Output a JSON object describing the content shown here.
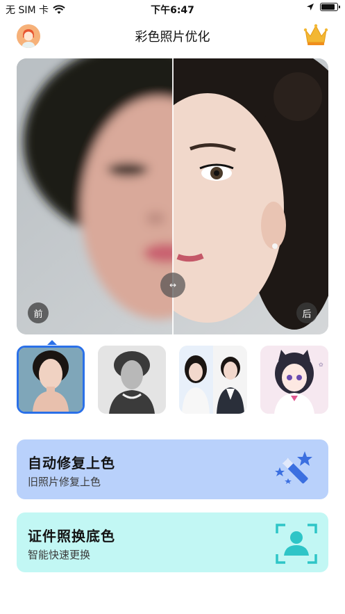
{
  "status_bar": {
    "carrier": "无 SIM 卡",
    "time": "下午6:47",
    "battery_level": 0.9
  },
  "header": {
    "title": "彩色照片优化",
    "avatar_icon": "user-avatar-icon",
    "vip_icon": "crown-icon"
  },
  "compare": {
    "before_label": "前",
    "after_label": "后",
    "handle_label": "↔"
  },
  "thumbnails": [
    {
      "name": "portrait-woman",
      "selected": true
    },
    {
      "name": "vintage-portrait",
      "selected": false
    },
    {
      "name": "id-photo-pair",
      "selected": false
    },
    {
      "name": "anime-girl",
      "selected": false
    }
  ],
  "cards": {
    "restore": {
      "title": "自动修复上色",
      "subtitle": "旧照片修复上色",
      "icon": "magic-wand-icon",
      "bg": "#b9d1fb"
    },
    "id_photo": {
      "title": "证件照换底色",
      "subtitle": "智能快速更换",
      "icon": "person-scan-icon",
      "bg": "#c2f7f4"
    }
  },
  "colors": {
    "accent": "#2a70e8",
    "wand": "#3b6fe0",
    "teal": "#2ec5c7"
  }
}
